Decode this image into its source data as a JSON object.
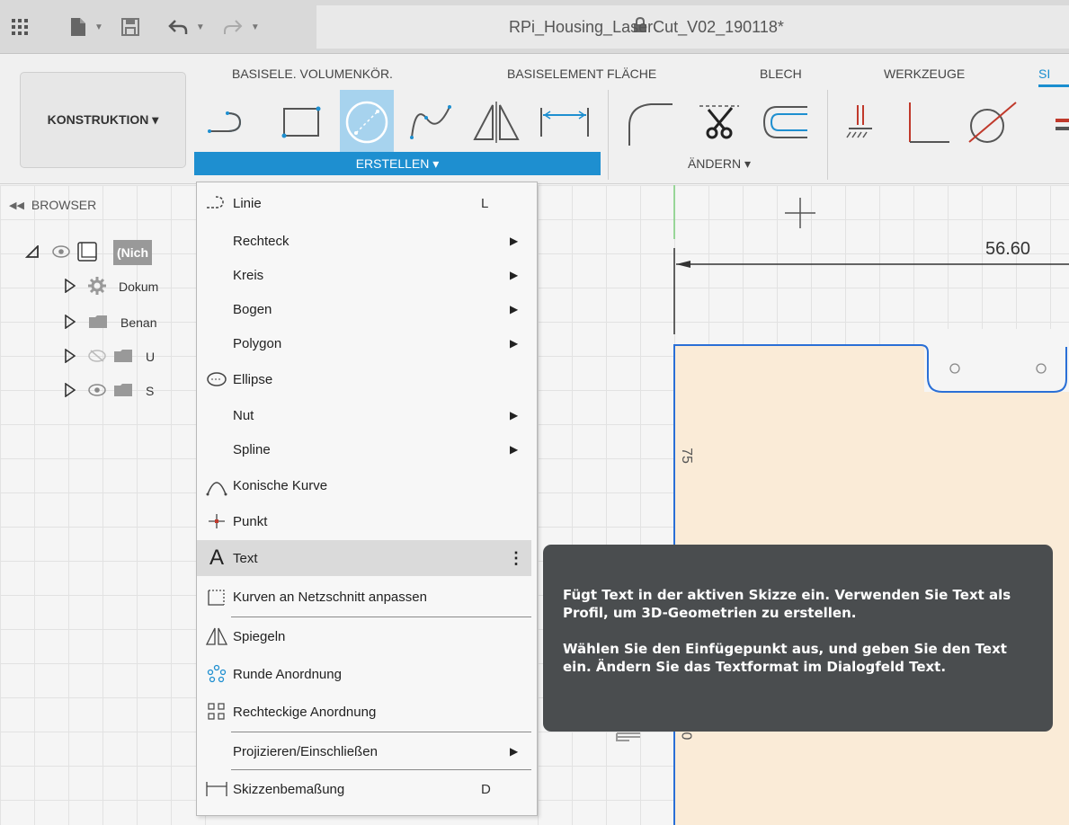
{
  "window": {
    "title": "RPi_Housing_LaserCut_V02_190118*",
    "toolbar_icons": [
      "apps-grid-icon",
      "file-icon",
      "save-icon",
      "undo-icon",
      "redo-icon"
    ]
  },
  "ribbon": {
    "workspace_label": "KONSTRUKTION ▾",
    "tabs": [
      "BASISELE. VOLUMENKÖR.",
      "BASISELEMENT FLÄCHE",
      "BLECH",
      "WERKZEUGE",
      "SI"
    ],
    "active_tab": "SI",
    "groups": {
      "create_label": "ERSTELLEN ▾",
      "modify_label": "ÄNDERN ▾"
    }
  },
  "browser": {
    "header": "BROWSER",
    "items": [
      {
        "label": "(Nich",
        "icon": "component-icon",
        "eye": "eye-icon"
      },
      {
        "label": "Dokum",
        "icon": "gear-icon"
      },
      {
        "label": "Benan",
        "icon": "folder-icon"
      },
      {
        "label": "U",
        "icon": "folder-icon",
        "eye": "eye-hidden-icon"
      },
      {
        "label": "S",
        "icon": "folder-icon",
        "eye": "eye-icon"
      }
    ]
  },
  "menu": {
    "items": [
      {
        "label": "Linie",
        "shortcut": "L",
        "icon": "line-icon"
      },
      {
        "label": "Rechteck",
        "submenu": "▶"
      },
      {
        "label": "Kreis",
        "submenu": "▶"
      },
      {
        "label": "Bogen",
        "submenu": "▶"
      },
      {
        "label": "Polygon",
        "submenu": "▶"
      },
      {
        "label": "Ellipse",
        "icon": "ellipse-icon"
      },
      {
        "label": "Nut",
        "submenu": "▶"
      },
      {
        "label": "Spline",
        "submenu": "▶"
      },
      {
        "label": "Konische Kurve",
        "icon": "conic-curve-icon"
      },
      {
        "label": "Punkt",
        "icon": "point-icon"
      },
      {
        "label": "Text",
        "icon": "text-icon",
        "more": "⋮",
        "highlighted": true
      },
      {
        "label": "Kurven an Netzschnitt anpassen",
        "icon": "mesh-fit-icon"
      },
      {
        "label": "Spiegeln",
        "icon": "mirror-icon"
      },
      {
        "label": "Runde Anordnung",
        "icon": "circular-pattern-icon"
      },
      {
        "label": "Rechteckige Anordnung",
        "icon": "rectangular-pattern-icon"
      },
      {
        "label": "Projizieren/Einschließen",
        "submenu": "▶"
      },
      {
        "label": "Skizzenbemaßung",
        "shortcut": "D",
        "icon": "dimension-icon"
      }
    ]
  },
  "tooltip": {
    "para1": "Fügt Text in der aktiven Skizze ein. Verwenden Sie Text als Profil, um 3D-Geometrien zu erstellen.",
    "para2": "Wählen Sie den Einfügepunkt aus, und geben Sie den Text ein. Ändern Sie das Textformat im Dialogfeld Text."
  },
  "canvas": {
    "dimension_horizontal": "56.60",
    "dimension_vertical": "75",
    "dimension_vertical_2": "0"
  },
  "colors": {
    "accent": "#1e8fd0",
    "sketch_fill": "#faebd7",
    "sketch_line": "#2a6fd6",
    "tooltip_bg": "#4a4d4f"
  }
}
